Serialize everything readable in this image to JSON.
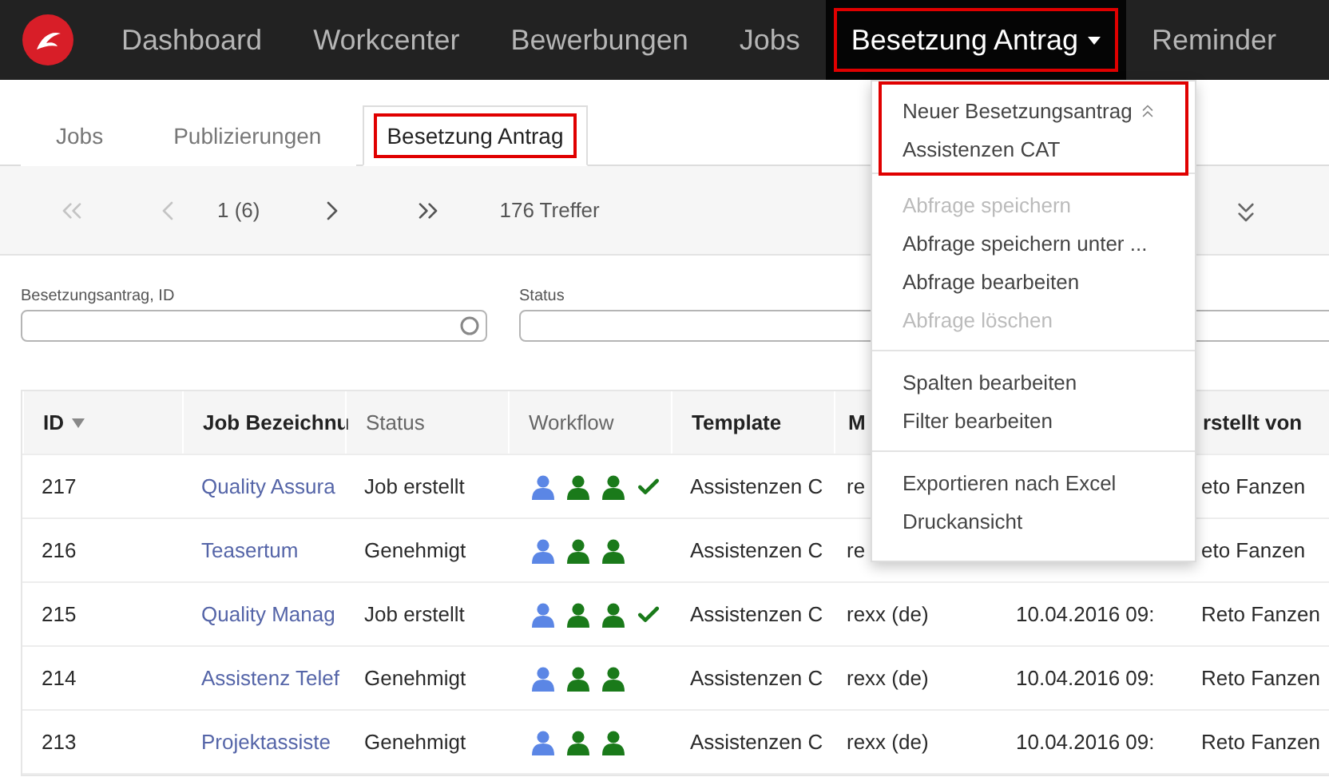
{
  "nav": {
    "items": [
      {
        "label": "Dashboard",
        "selected": false,
        "highlighted": false,
        "dropdown": false
      },
      {
        "label": "Workcenter",
        "selected": false,
        "highlighted": false,
        "dropdown": false
      },
      {
        "label": "Bewerbungen",
        "selected": false,
        "highlighted": false,
        "dropdown": false
      },
      {
        "label": "Jobs",
        "selected": false,
        "highlighted": false,
        "dropdown": false
      },
      {
        "label": "Besetzung Antrag",
        "selected": true,
        "highlighted": true,
        "dropdown": true
      },
      {
        "label": "Reminder",
        "selected": false,
        "highlighted": false,
        "dropdown": false
      }
    ]
  },
  "tabs": [
    {
      "label": "Jobs",
      "selected": false,
      "highlighted": false
    },
    {
      "label": "Publizierungen",
      "selected": false,
      "highlighted": false
    },
    {
      "label": "Besetzung Antrag",
      "selected": true,
      "highlighted": true
    }
  ],
  "pager": {
    "buttons": [
      {
        "kind": "first",
        "disabled": true
      },
      {
        "kind": "prev",
        "disabled": true
      },
      {
        "kind": "page",
        "label": "1 (6)"
      },
      {
        "kind": "next",
        "disabled": false
      },
      {
        "kind": "last",
        "disabled": false
      }
    ],
    "hits": "176 Treffer"
  },
  "filters": [
    {
      "label": "Besetzungsantrag, ID",
      "kind": "search"
    },
    {
      "label": "Status",
      "kind": "plain"
    }
  ],
  "table": {
    "columns": {
      "id": {
        "label": "ID",
        "sortable": true,
        "sorted": true
      },
      "job": {
        "label": "Job Bezeichnu",
        "sortable": true
      },
      "status": {
        "label": "Status",
        "sortable": false
      },
      "workflow": {
        "label": "Workflow",
        "sortable": false
      },
      "template": {
        "label": "Template",
        "sortable": true
      },
      "column_6": {
        "label": "M",
        "sortable": true
      },
      "column_8": {
        "label": "rstellt von",
        "sortable": true
      }
    },
    "rows": [
      {
        "id": "217",
        "job": "Quality Assura",
        "status": "Job erstellt",
        "workflow": [
          {
            "kind": "person",
            "color": "#5b86e5"
          },
          {
            "kind": "person",
            "color": "#1a7a1a"
          },
          {
            "kind": "person",
            "color": "#1a7a1a"
          },
          {
            "kind": "check",
            "color": "#1a7a1a"
          }
        ],
        "template": "Assistenzen C",
        "column_6": "re",
        "column_8": "eto Fanzen"
      },
      {
        "id": "216",
        "job": "Teasertum",
        "status": "Genehmigt",
        "workflow": [
          {
            "kind": "person",
            "color": "#5b86e5"
          },
          {
            "kind": "person",
            "color": "#1a7a1a"
          },
          {
            "kind": "person",
            "color": "#1a7a1a"
          }
        ],
        "template": "Assistenzen C",
        "column_6": "re",
        "column_8": "eto Fanzen"
      },
      {
        "id": "215",
        "job": "Quality Manag",
        "status": "Job erstellt",
        "workflow": [
          {
            "kind": "person",
            "color": "#5b86e5"
          },
          {
            "kind": "person",
            "color": "#1a7a1a"
          },
          {
            "kind": "person",
            "color": "#1a7a1a"
          },
          {
            "kind": "check",
            "color": "#1a7a1a"
          }
        ],
        "template": "Assistenzen C",
        "column_6": "rexx (de)",
        "column_7": "10.04.2016 09:",
        "column_8": "Reto Fanzen"
      },
      {
        "id": "214",
        "job": "Assistenz Telef",
        "status": "Genehmigt",
        "workflow": [
          {
            "kind": "person",
            "color": "#5b86e5"
          },
          {
            "kind": "person",
            "color": "#1a7a1a"
          },
          {
            "kind": "person",
            "color": "#1a7a1a"
          }
        ],
        "template": "Assistenzen C",
        "column_6": "rexx (de)",
        "column_7": "10.04.2016 09:",
        "column_8": "Reto Fanzen"
      },
      {
        "id": "213",
        "job": "Projektassiste",
        "status": "Genehmigt",
        "workflow": [
          {
            "kind": "person",
            "color": "#5b86e5"
          },
          {
            "kind": "person",
            "color": "#1a7a1a"
          },
          {
            "kind": "person",
            "color": "#1a7a1a"
          }
        ],
        "template": "Assistenzen C",
        "column_6": "rexx (de)",
        "column_7": "10.04.2016 09:",
        "column_8": "Reto Fanzen"
      }
    ]
  },
  "menu": {
    "groups": [
      {
        "highlighted": true,
        "items": [
          {
            "label": "Neuer Besetzungsantrag",
            "disabled": false,
            "collapsible": true
          },
          {
            "label": "Assistenzen CAT",
            "disabled": false,
            "collapsible": false
          }
        ]
      },
      {
        "highlighted": false,
        "items": [
          {
            "label": "Abfrage speichern",
            "disabled": true,
            "collapsible": false
          },
          {
            "label": "Abfrage speichern unter ...",
            "disabled": false,
            "collapsible": false
          },
          {
            "label": "Abfrage bearbeiten",
            "disabled": false,
            "collapsible": false
          },
          {
            "label": "Abfrage löschen",
            "disabled": true,
            "collapsible": false
          }
        ]
      },
      {
        "highlighted": false,
        "items": [
          {
            "label": "Spalten bearbeiten",
            "disabled": false,
            "collapsible": false
          },
          {
            "label": "Filter bearbeiten",
            "disabled": false,
            "collapsible": false
          }
        ]
      },
      {
        "highlighted": false,
        "items": [
          {
            "label": "Exportieren nach Excel",
            "disabled": false,
            "collapsible": false
          },
          {
            "label": "Druckansicht",
            "disabled": false,
            "collapsible": false
          }
        ]
      }
    ]
  }
}
